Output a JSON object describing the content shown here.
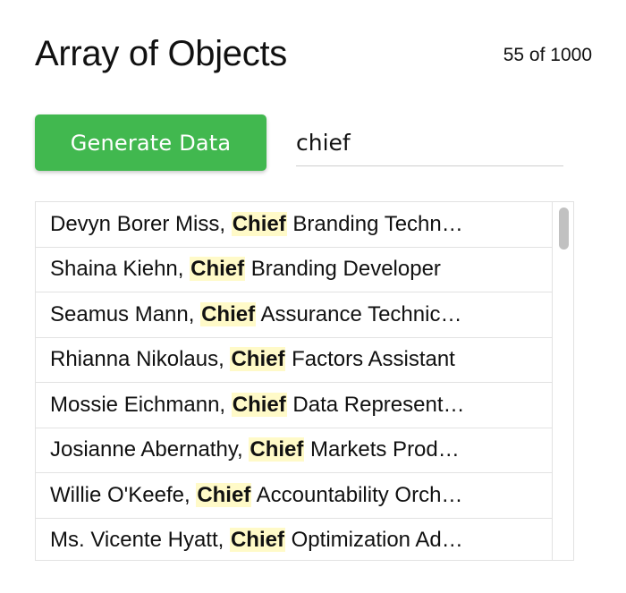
{
  "header": {
    "title": "Array of Objects",
    "count": "55 of 1000"
  },
  "toolbar": {
    "generate_label": "Generate Data"
  },
  "search": {
    "value": "chief",
    "highlight_term": "Chief"
  },
  "list": {
    "items": [
      {
        "before": "Devyn Borer Miss, ",
        "match": "Chief",
        "after": " Branding Techn…"
      },
      {
        "before": "Shaina Kiehn, ",
        "match": "Chief",
        "after": " Branding Developer"
      },
      {
        "before": "Seamus Mann, ",
        "match": "Chief",
        "after": " Assurance Technic…"
      },
      {
        "before": "Rhianna Nikolaus, ",
        "match": "Chief",
        "after": " Factors Assistant"
      },
      {
        "before": "Mossie Eichmann, ",
        "match": "Chief",
        "after": " Data Represent…"
      },
      {
        "before": "Josianne Abernathy, ",
        "match": "Chief",
        "after": " Markets Prod…"
      },
      {
        "before": "Willie O'Keefe, ",
        "match": "Chief",
        "after": " Accountability Orch…"
      },
      {
        "before": "Ms. Vicente Hyatt, ",
        "match": "Chief",
        "after": " Optimization Ad…"
      }
    ]
  },
  "colors": {
    "button_bg": "#41b84f",
    "highlight_bg": "#fffac8"
  }
}
